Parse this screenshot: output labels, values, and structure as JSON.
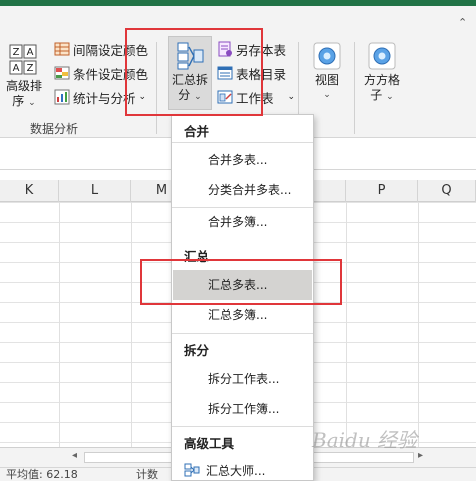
{
  "ribbon": {
    "sort_button": {
      "label_line1": "高级排",
      "label_line2": "序",
      "chevron": "⌄"
    },
    "small_buttons_col1": [
      {
        "label": "间隔设定颜色",
        "icon": "grid-color-icon"
      },
      {
        "label": "条件设定颜色",
        "icon": "condition-color-icon"
      },
      {
        "label": "统计与分析",
        "icon": "statistics-icon"
      }
    ],
    "stats_chevron": "⌄",
    "group_label": "数据分析",
    "merge_button": {
      "label_line1": "汇总拆",
      "label_line2": "分",
      "chevron": "⌄"
    },
    "small_buttons_col2": [
      {
        "label": "另存本表",
        "icon": "save-sheet-icon"
      },
      {
        "label": "表格目录",
        "icon": "sheet-directory-icon"
      },
      {
        "label": "工作表",
        "icon": "worksheet-icon"
      }
    ],
    "worksheet_chevron": "⌄",
    "view_button": {
      "label": "视图",
      "chevron": "⌄"
    },
    "grid_button": {
      "label_line1": "方方格",
      "label_line2": "子",
      "chevron": "⌄"
    }
  },
  "columns": [
    "K",
    "L",
    "M",
    "",
    "P",
    "Q"
  ],
  "menu": {
    "sections": [
      {
        "header": "合并",
        "items": [
          "合并多表...",
          "分类合并多表...",
          "合并多簿..."
        ]
      },
      {
        "header": "汇总",
        "items": [
          "汇总多表...",
          "汇总多簿..."
        ]
      },
      {
        "header": "拆分",
        "items": [
          "拆分工作表...",
          "拆分工作簿..."
        ]
      },
      {
        "header": "高级工具",
        "items": [
          "汇总大师..."
        ]
      }
    ],
    "selected_item": "汇总多表..."
  },
  "statusbar": {
    "left": "平均值: 62.18",
    "middle": "计数"
  },
  "colors": {
    "accent": "#217346",
    "highlight": "#e0363a"
  }
}
